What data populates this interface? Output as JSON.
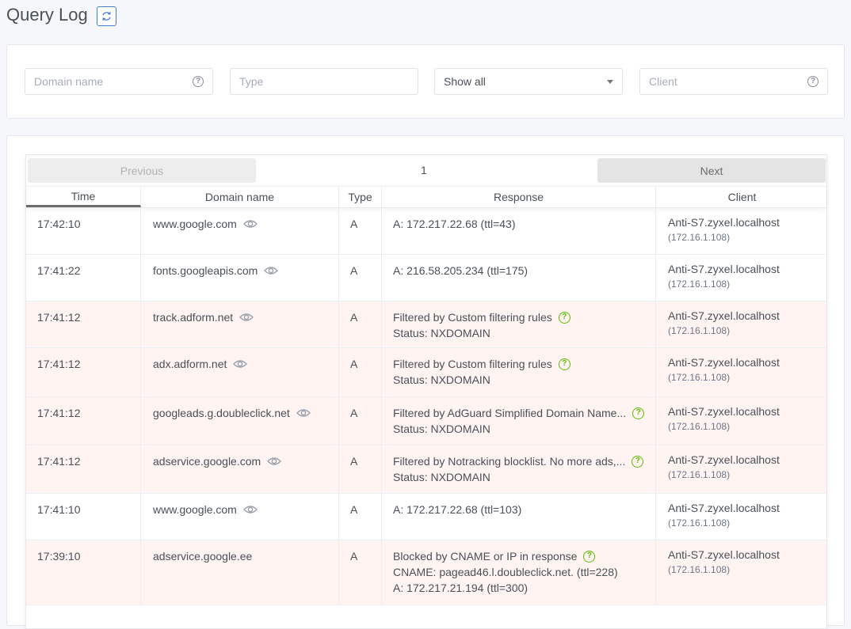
{
  "header": {
    "title": "Query Log",
    "refresh_icon": "refresh-icon"
  },
  "filters": {
    "domain_placeholder": "Domain name",
    "type_placeholder": "Type",
    "response_select": "Show all",
    "client_placeholder": "Client"
  },
  "pagination": {
    "previous": "Previous",
    "page": "1",
    "next": "Next"
  },
  "columns": [
    "Time",
    "Domain name",
    "Type",
    "Response",
    "Client"
  ],
  "rows": [
    {
      "time": "17:42:10",
      "domain": "www.google.com",
      "type": "A",
      "response": [
        "A: 172.217.22.68 (ttl=43)"
      ],
      "client": "Anti-S7.zyxel.localhost",
      "ip": "(172.16.1.108)"
    },
    {
      "time": "17:41:22",
      "domain": "fonts.googleapis.com",
      "type": "A",
      "response": [
        "A: 216.58.205.234 (ttl=175)"
      ],
      "client": "Anti-S7.zyxel.localhost",
      "ip": "(172.16.1.108)"
    },
    {
      "time": "17:41:12",
      "domain": "track.adform.net",
      "type": "A",
      "response": [
        "Filtered by Custom filtering rules",
        "Status: NXDOMAIN"
      ],
      "client": "Anti-S7.zyxel.localhost",
      "ip": "(172.16.1.108)"
    },
    {
      "time": "17:41:12",
      "domain": "adx.adform.net",
      "type": "A",
      "response": [
        "Filtered by Custom filtering rules",
        "Status: NXDOMAIN"
      ],
      "client": "Anti-S7.zyxel.localhost",
      "ip": "(172.16.1.108)"
    },
    {
      "time": "17:41:12",
      "domain": "googleads.g.doubleclick.net",
      "type": "A",
      "response": [
        "Filtered by AdGuard Simplified Domain Name...",
        "Status: NXDOMAIN"
      ],
      "client": "Anti-S7.zyxel.localhost",
      "ip": "(172.16.1.108)"
    },
    {
      "time": "17:41:12",
      "domain": "adservice.google.com",
      "type": "A",
      "response": [
        "Filtered by Notracking blocklist. No more ads,...",
        "Status: NXDOMAIN"
      ],
      "client": "Anti-S7.zyxel.localhost",
      "ip": "(172.16.1.108)"
    },
    {
      "time": "17:41:10",
      "domain": "www.google.com",
      "type": "A",
      "response": [
        "A: 172.217.22.68 (ttl=103)"
      ],
      "client": "Anti-S7.zyxel.localhost",
      "ip": "(172.16.1.108)"
    },
    {
      "time": "17:39:10",
      "domain": "adservice.google.ee",
      "type": "A",
      "response": [
        "Blocked by CNAME or IP in response",
        "CNAME: pagead46.l.doubleclick.net. (ttl=228)",
        "A: 172.217.21.194 (ttl=300)"
      ],
      "client": "Anti-S7.zyxel.localhost",
      "ip": "(172.16.1.108)"
    }
  ],
  "colors": {
    "filtered_row": "#fff4f2",
    "help_green": "#5eba00",
    "accent": "#467fcf"
  }
}
